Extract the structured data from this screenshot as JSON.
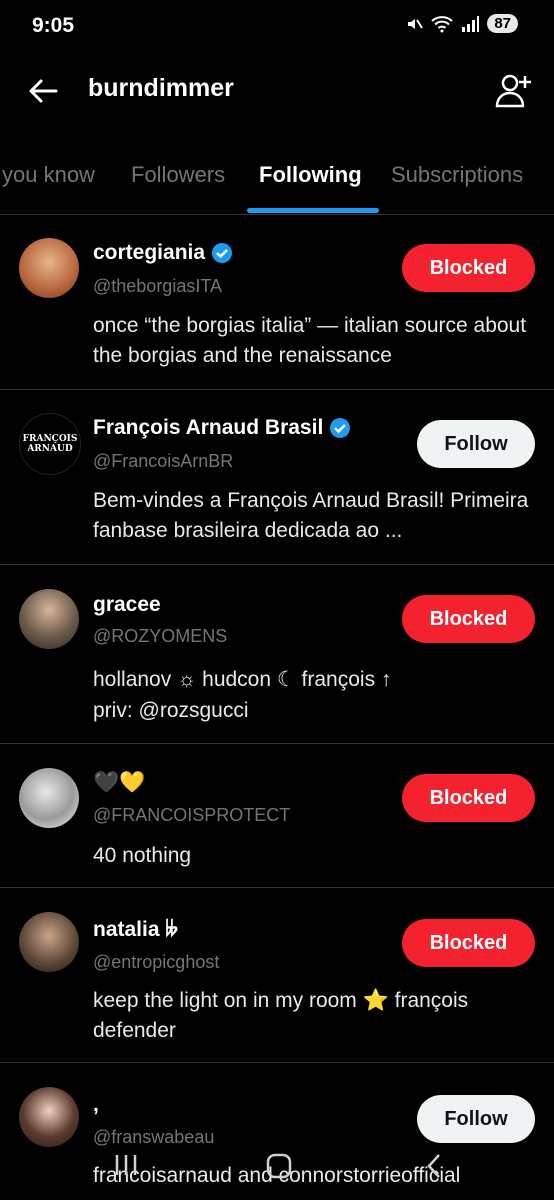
{
  "status": {
    "time": "9:05",
    "battery": "87"
  },
  "header": {
    "title": "burndimmer"
  },
  "tabs": [
    {
      "label": "you know"
    },
    {
      "label": "Followers"
    },
    {
      "label": "Following"
    },
    {
      "label": "Subscriptions"
    }
  ],
  "accounts": [
    {
      "name": "cortegiania",
      "handle": "@theborgiasITA",
      "bio": "once “the borgias italia” — italian source about the borgias and the renaissance",
      "button": "Blocked"
    },
    {
      "name": "François Arnaud Brasil",
      "handle": "@FrancoisArnBR",
      "bio": "Bem-vindes a François Arnaud Brasil! Primeira fanbase brasileira dedicada ao ...",
      "button": "Follow",
      "avatar_text": "FRANÇOIS ARNAUD"
    },
    {
      "name": "gracee",
      "handle": "@ROZYOMENS",
      "bio_line1": "hollanov ☼ hudcon ☾ françois ↑",
      "bio_line2": "priv: @rozsgucci",
      "button": "Blocked"
    },
    {
      "name": "🖤💛",
      "handle": "@FRANCOISPROTECT",
      "bio": "40 nothing",
      "button": "Blocked"
    },
    {
      "name": "natalia 𝄫",
      "handle": "@entropicghost",
      "bio": "keep the light on in my room ⭐ françois defender",
      "button": "Blocked"
    },
    {
      "name": ",",
      "handle": "@franswabeau",
      "bio": "francoisarnaud and connorstorrieofficial",
      "button": "Follow"
    }
  ],
  "colors": {
    "accent": "#1d9bf0",
    "blocked": "#f4212e",
    "background": "#000000"
  }
}
